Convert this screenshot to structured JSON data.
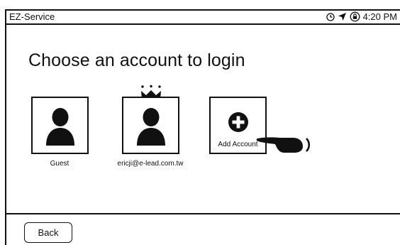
{
  "statusbar": {
    "app_title": "EZ-Service",
    "time": "4:20 PM",
    "icons": [
      "clock-icon",
      "location-arrow-icon",
      "lock-rotation-icon"
    ]
  },
  "page": {
    "title": "Choose an account to login"
  },
  "accounts": [
    {
      "label": "Guest",
      "icon": "user-avatar-icon"
    },
    {
      "label": "ericji@e-lead.com.tw",
      "icon": "user-avatar-icon",
      "badge_icon": "crown-icon"
    }
  ],
  "add_account": {
    "label": "Add Account",
    "icon": "plus-circle-icon"
  },
  "gesture": {
    "icon": "pointing-hand-icon"
  },
  "footer": {
    "back_label": "Back"
  }
}
